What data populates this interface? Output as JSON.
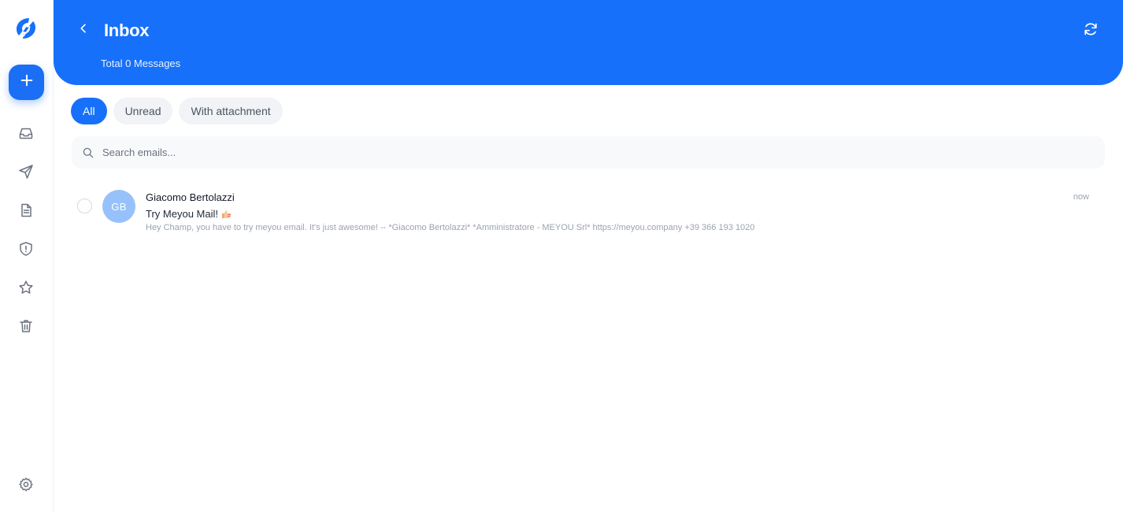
{
  "sidebar": {
    "logo_icon": "meyou-logo-icon",
    "compose_icon": "plus-icon",
    "items": [
      {
        "name": "inbox",
        "icon": "inbox-icon"
      },
      {
        "name": "sent",
        "icon": "paper-plane-icon"
      },
      {
        "name": "drafts",
        "icon": "document-icon"
      },
      {
        "name": "spam",
        "icon": "shield-alert-icon"
      },
      {
        "name": "starred",
        "icon": "star-icon"
      },
      {
        "name": "trash",
        "icon": "trash-icon"
      }
    ],
    "settings_icon": "gear-icon"
  },
  "header": {
    "title": "Inbox",
    "subtitle": "Total 0 Messages",
    "back_icon": "chevron-left-icon",
    "refresh_icon": "refresh-icon",
    "background": "#1670fa"
  },
  "filters": [
    {
      "label": "All",
      "active": true
    },
    {
      "label": "Unread",
      "active": false
    },
    {
      "label": "With attachment",
      "active": false
    }
  ],
  "search": {
    "placeholder": "Search emails..."
  },
  "emails": [
    {
      "initials": "GB",
      "sender": "Giacomo Bertolazzi",
      "subject": "Try Meyou Mail!",
      "subject_emoji": "thumbs-up-emoji",
      "preview": "Hey Champ, you have to try meyou email. It's just awesome! -- *Giacomo Bertolazzi* *Amministratore - MEYOU Srl* https://meyou.company +39 366 193 1020",
      "time": "now",
      "avatar_color": "#97c1fb"
    }
  ],
  "colors": {
    "accent": "#1670fa",
    "chip_bg": "#f1f3f6",
    "icon_gray": "#6b7280"
  }
}
